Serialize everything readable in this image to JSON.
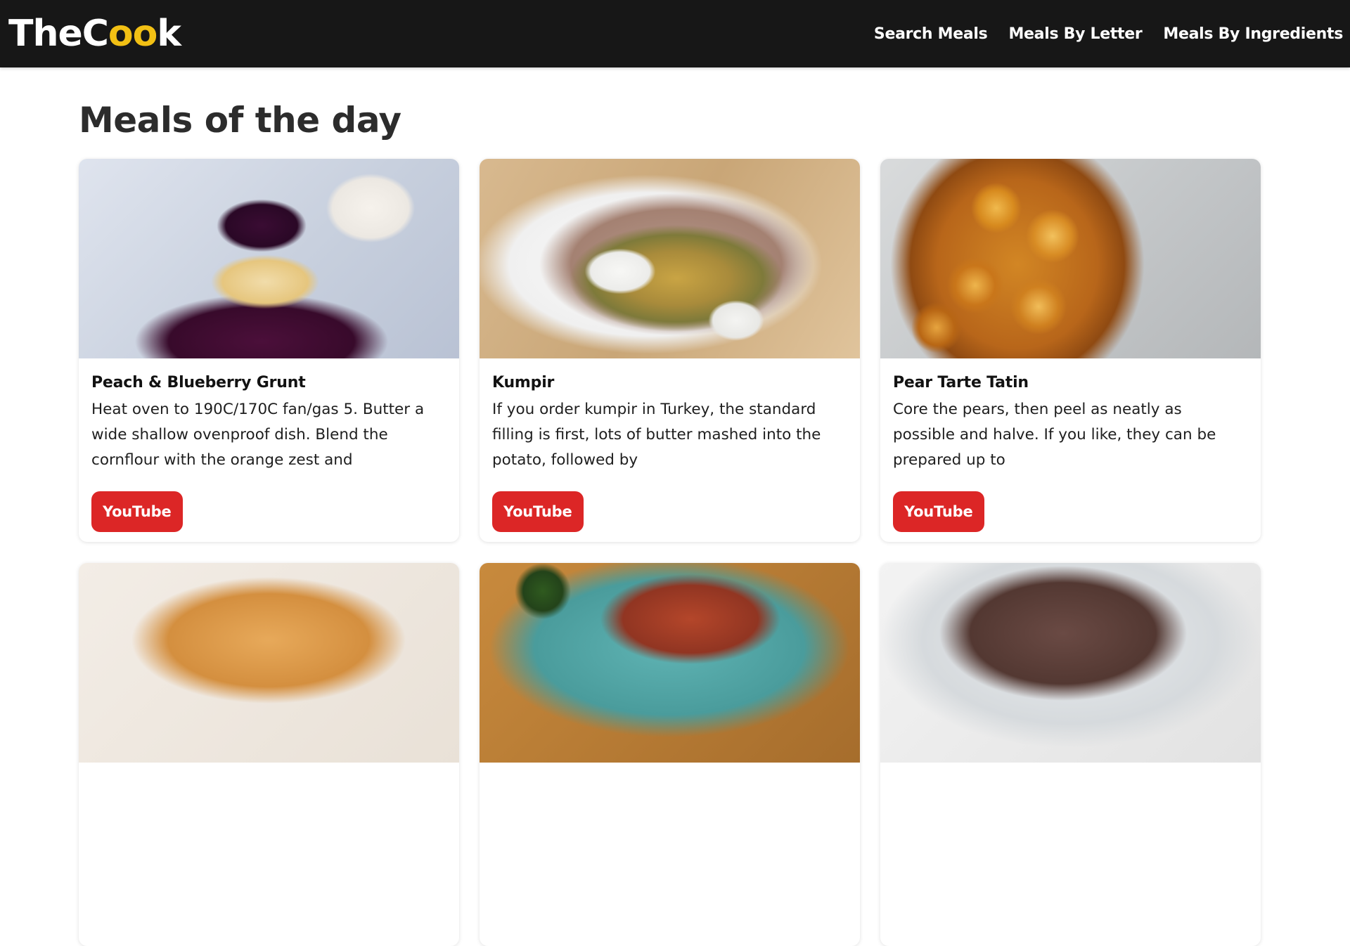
{
  "header": {
    "logo_part1": "TheC",
    "logo_part2": "oo",
    "logo_part3": "k",
    "nav": [
      {
        "label": "Search Meals"
      },
      {
        "label": "Meals By Letter"
      },
      {
        "label": "Meals By Ingredients"
      }
    ]
  },
  "main": {
    "title": "Meals of the day",
    "meals": [
      {
        "name": "Peach & Blueberry Grunt",
        "description": "Heat oven to 190C/170C fan/gas 5. Butter a wide shallow ovenproof dish. Blend the cornflour with the orange zest and",
        "button_label": "YouTube",
        "image_icon": "meal-photo-dessert"
      },
      {
        "name": "Kumpir",
        "description": "If you order kumpir in Turkey, the standard filling is first, lots of butter mashed into the potato, followed by",
        "button_label": "YouTube",
        "image_icon": "meal-photo-potato"
      },
      {
        "name": "Pear Tarte Tatin",
        "description": "Core the pears, then peel as neatly as possible and halve. If you like, they can be prepared up to",
        "button_label": "YouTube",
        "image_icon": "meal-photo-tart"
      }
    ]
  },
  "colors": {
    "header_bg": "#171717",
    "logo_accent": "#f2c014",
    "button_bg": "#dc2626"
  }
}
